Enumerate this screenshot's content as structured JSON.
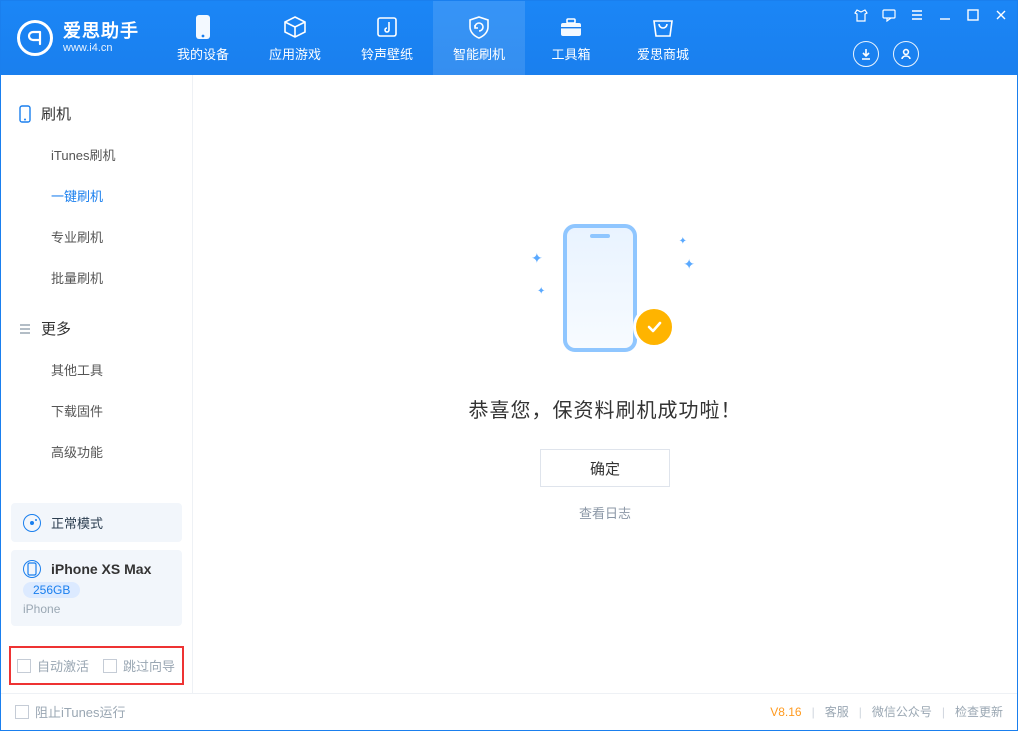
{
  "app": {
    "name_cn": "爱思助手",
    "name_en": "www.i4.cn"
  },
  "nav": {
    "items": [
      {
        "label": "我的设备",
        "icon": "device"
      },
      {
        "label": "应用游戏",
        "icon": "cube"
      },
      {
        "label": "铃声壁纸",
        "icon": "music"
      },
      {
        "label": "智能刷机",
        "icon": "refresh",
        "active": true
      },
      {
        "label": "工具箱",
        "icon": "toolbox"
      },
      {
        "label": "爱思商城",
        "icon": "store"
      }
    ]
  },
  "sidebar": {
    "section1_title": "刷机",
    "section1_items": [
      {
        "label": "iTunes刷机"
      },
      {
        "label": "一键刷机",
        "active": true
      },
      {
        "label": "专业刷机"
      },
      {
        "label": "批量刷机"
      }
    ],
    "section2_title": "更多",
    "section2_items": [
      {
        "label": "其他工具"
      },
      {
        "label": "下载固件"
      },
      {
        "label": "高级功能"
      }
    ]
  },
  "device": {
    "mode_label": "正常模式",
    "name": "iPhone XS Max",
    "storage": "256GB",
    "type": "iPhone"
  },
  "options": {
    "auto_activate": "自动激活",
    "skip_guide": "跳过向导"
  },
  "content": {
    "success_text": "恭喜您，保资料刷机成功啦！",
    "ok_label": "确定",
    "log_label": "查看日志"
  },
  "statusbar": {
    "block_itunes": "阻止iTunes运行",
    "version": "V8.16",
    "support": "客服",
    "wechat": "微信公众号",
    "check_update": "检查更新"
  }
}
